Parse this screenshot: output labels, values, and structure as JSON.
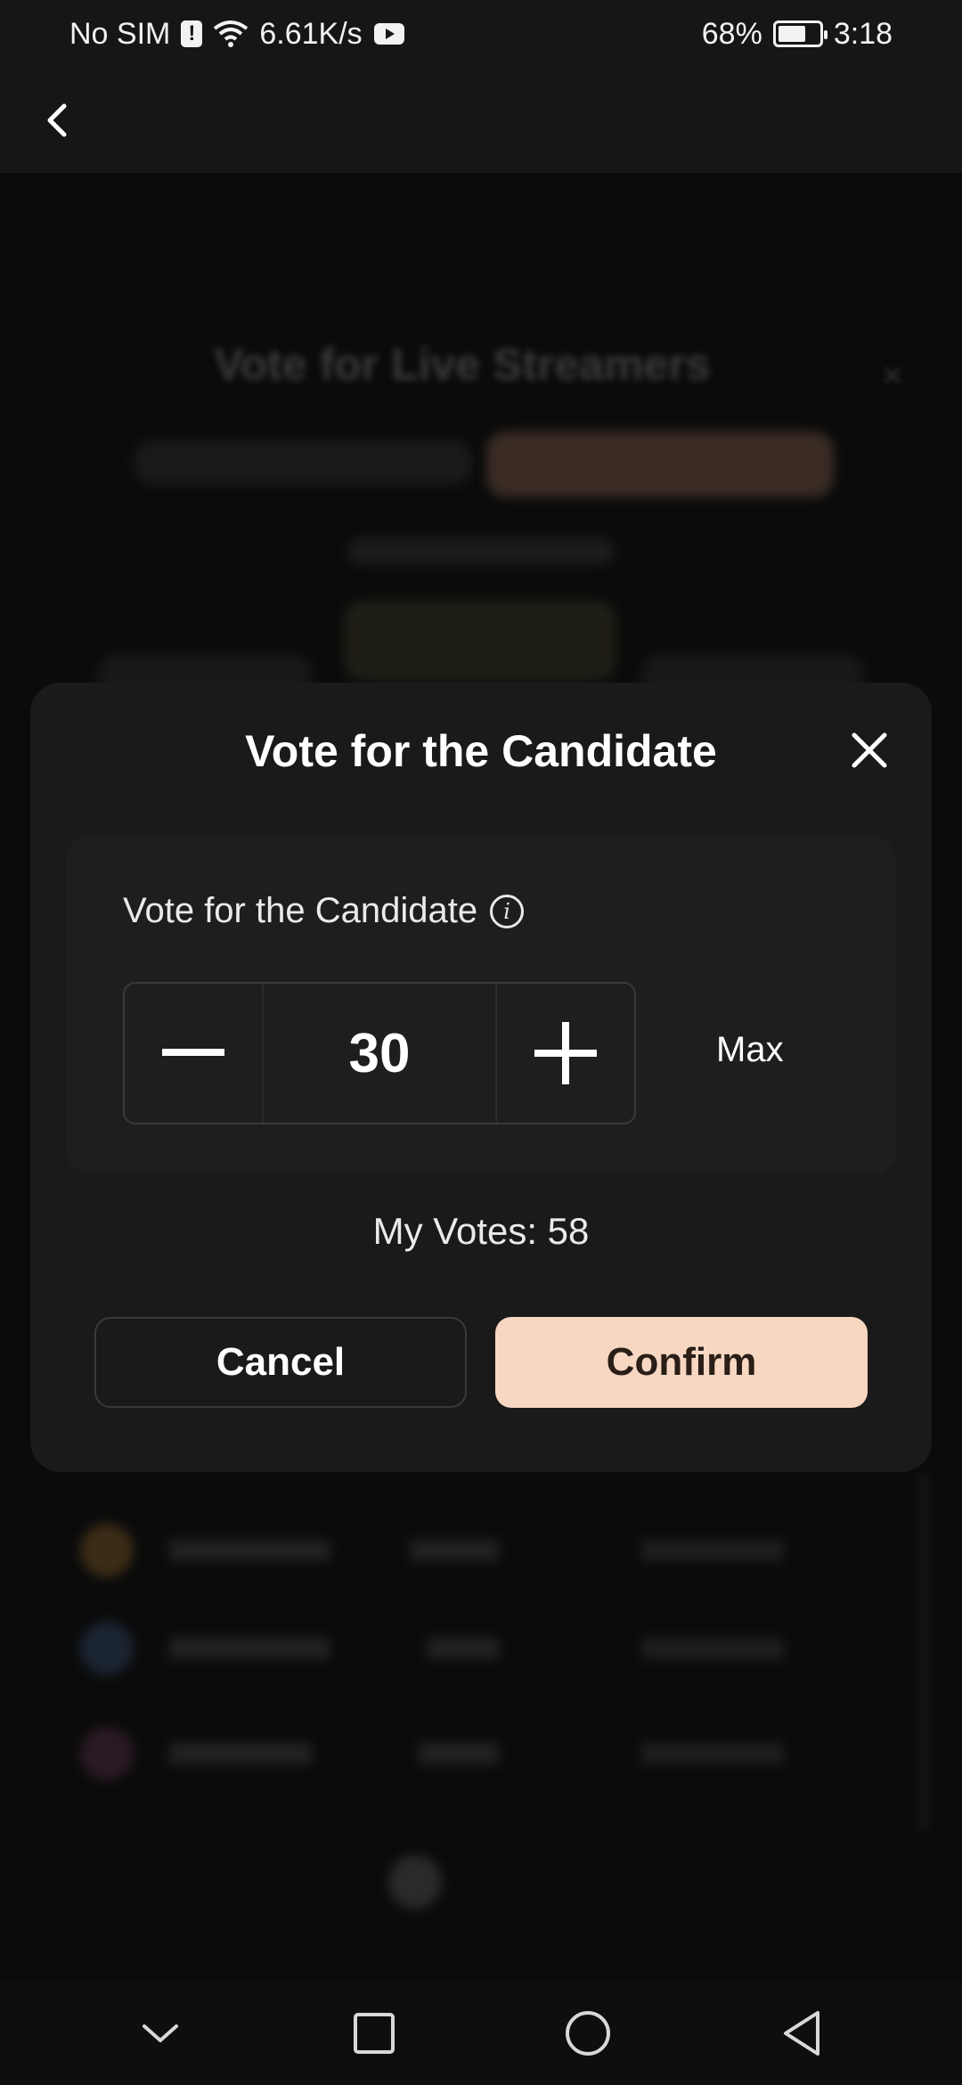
{
  "status_bar": {
    "carrier": "No SIM",
    "network_speed": "6.61K/s",
    "battery": "68%",
    "battery_level": 0.68,
    "time": "3:18"
  },
  "background": {
    "title": "Vote for Live Streamers"
  },
  "modal": {
    "title": "Vote for the Candidate",
    "field_label": "Vote for the Candidate",
    "vote_value": "30",
    "max_label": "Max",
    "my_votes": "My Votes: 58",
    "cancel_label": "Cancel",
    "confirm_label": "Confirm"
  },
  "colors": {
    "modal_bg": "#1b1a1a",
    "confirm_bg": "#f7d7c2",
    "confirm_text": "#2a1e17"
  },
  "icons": {
    "back": "chevron-left-icon",
    "close": "close-icon",
    "info": "info-icon",
    "minus": "minus-icon",
    "plus": "plus-icon"
  }
}
